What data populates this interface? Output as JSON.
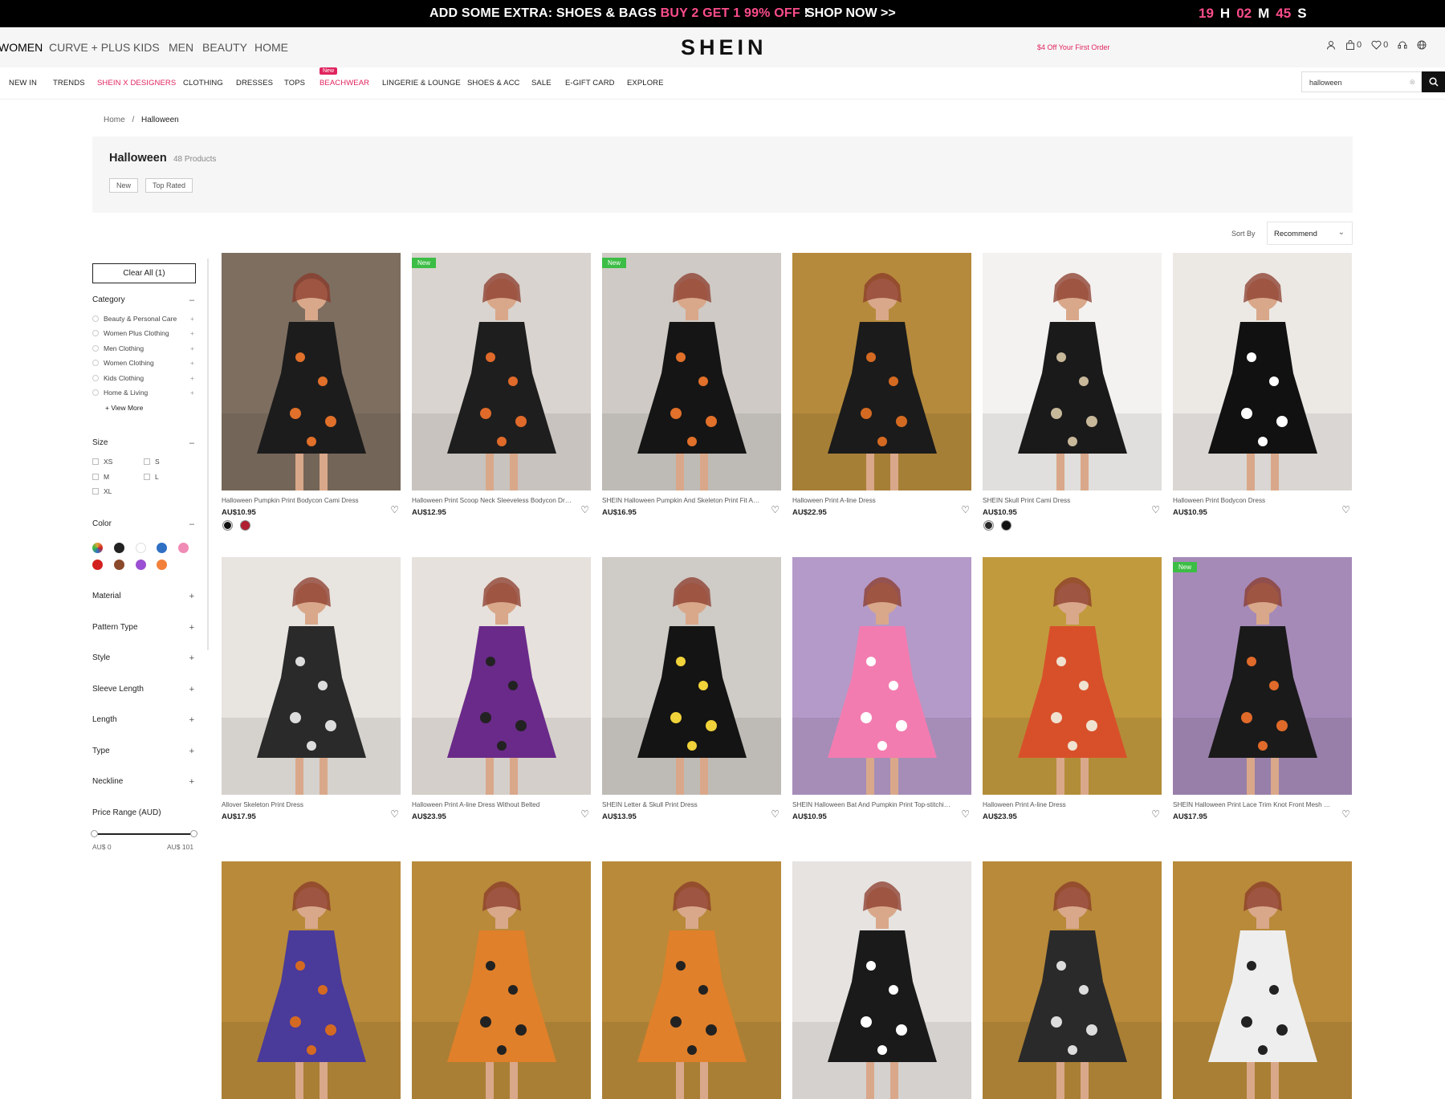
{
  "promo": {
    "part1": "ADD SOME EXTRA: SHOES & BAGS ",
    "highlight": "BUY 2 GET 1 99% OFF",
    "part2": " !",
    "shop": "SHOP NOW >>",
    "hours": "19",
    "h": "H",
    "minutes": "02",
    "m": "M",
    "seconds": "45",
    "s": "S"
  },
  "header": {
    "categories": [
      "WOMEN",
      "CURVE + PLUS",
      "KIDS",
      "MEN",
      "BEAUTY",
      "HOME"
    ],
    "logo": "SHEIN",
    "offer": "$4 Off Your First Order",
    "bag_count": "0",
    "wish_count": "0"
  },
  "nav": {
    "items": [
      "NEW IN",
      "TRENDS",
      "SHEIN X DESIGNERS",
      "CLOTHING",
      "DRESSES",
      "TOPS",
      "BEACHWEAR",
      "LINGERIE & LOUNGE",
      "SHOES & ACC",
      "SALE",
      "E-GIFT CARD",
      "EXPLORE"
    ],
    "new_badge": "New",
    "search_value": "halloween"
  },
  "breadcrumb": {
    "home": "Home",
    "sep": "/",
    "current": "Halloween"
  },
  "listing": {
    "title": "Halloween",
    "count": "48 Products",
    "chip_new": "New",
    "chip_top": "Top Rated",
    "sort_label": "Sort By",
    "sort_value": "Recommend"
  },
  "filters": {
    "clear_all": "Clear All (1)",
    "category": "Category",
    "category_items": [
      "Beauty & Personal Care",
      "Women Plus Clothing",
      "Men Clothing",
      "Women Clothing",
      "Kids Clothing",
      "Home & Living"
    ],
    "view_more": "+ View More",
    "size": "Size",
    "sizes": [
      "XS",
      "S",
      "M",
      "L",
      "XL"
    ],
    "color": "Color",
    "colors": [
      "#e8a23a",
      "#222222",
      "#ffffff",
      "#2f6fc4",
      "#f08bb5",
      "#d22020",
      "#8b4a2b",
      "#9b4fd2",
      "#f2803a"
    ],
    "material": "Material",
    "pattern_type": "Pattern Type",
    "style": "Style",
    "sleeve_length": "Sleeve Length",
    "length": "Length",
    "type": "Type",
    "neckline": "Neckline",
    "price_range": "Price Range (AUD)",
    "price_min": "AU$ 0",
    "price_max": "AU$ 101",
    "minus": "–",
    "plus": "+"
  },
  "products": [
    {
      "name": "Halloween Pumpkin Print Bodycon Cami Dress",
      "price": "AU$10.95",
      "badge": "",
      "bg": "#7d6e60",
      "dress": "#1c1c1c",
      "accent": "#e0702a",
      "dots": [
        "#111111",
        "#b02030"
      ]
    },
    {
      "name": "Halloween Print Scoop Neck Sleeveless Bodycon Dress",
      "price": "AU$12.95",
      "badge": "New",
      "bg": "#d9d4cf",
      "dress": "#1e1e1e",
      "accent": "#e06a2a",
      "dots": []
    },
    {
      "name": "SHEIN Halloween Pumpkin And Skeleton Print Fit And Flare Dress",
      "price": "AU$16.95",
      "badge": "New",
      "bg": "#cfcac5",
      "dress": "#151515",
      "accent": "#e0702a",
      "dots": []
    },
    {
      "name": "Halloween Print A-line Dress",
      "price": "AU$22.95",
      "badge": "",
      "bg": "#b58a3c",
      "dress": "#1b1b1b",
      "accent": "#d46a22",
      "dots": []
    },
    {
      "name": "SHEIN Skull Print Cami Dress",
      "price": "AU$10.95",
      "badge": "",
      "bg": "#f4f2f0",
      "dress": "#1a1a1a",
      "accent": "#c8b89a",
      "dots": [
        "#2a2a2a",
        "#111111"
      ]
    },
    {
      "name": "Halloween Print Bodycon Dress",
      "price": "AU$10.95",
      "badge": "",
      "bg": "#ece9e5",
      "dress": "#111111",
      "accent": "#ffffff",
      "dots": []
    },
    {
      "name": "Allover Skeleton Print Dress",
      "price": "AU$17.95",
      "badge": "",
      "bg": "#e8e4e0",
      "dress": "#2a2a2a",
      "accent": "#dddddd",
      "dots": []
    },
    {
      "name": "Halloween Print A-line Dress Without Belted",
      "price": "AU$23.95",
      "badge": "",
      "bg": "#e6e1dc",
      "dress": "#6a2a8a",
      "accent": "#222222",
      "dots": []
    },
    {
      "name": "SHEIN Letter & Skull Print Dress",
      "price": "AU$13.95",
      "badge": "",
      "bg": "#cfcbc6",
      "dress": "#141414",
      "accent": "#f0d23a",
      "dots": []
    },
    {
      "name": "SHEIN Halloween Bat And Pumpkin Print Top-stitching Bodycon Dress",
      "price": "AU$10.95",
      "badge": "",
      "bg": "#b49ac8",
      "dress": "#f27cb0",
      "accent": "#ffffff",
      "dots": []
    },
    {
      "name": "Halloween Print A-line Dress",
      "price": "AU$23.95",
      "badge": "",
      "bg": "#c29a3e",
      "dress": "#d8502a",
      "accent": "#f0e2d0",
      "dots": []
    },
    {
      "name": "SHEIN Halloween Print Lace Trim Knot Front Mesh Cami Dress",
      "price": "AU$17.95",
      "badge": "New",
      "bg": "#a58ab8",
      "dress": "#1a1a1a",
      "accent": "#e06a2a",
      "dots": []
    },
    {
      "name": "",
      "price": "",
      "badge": "",
      "bg": "#b88a3a",
      "dress": "#4a3a9a",
      "accent": "#d46a22",
      "dots": []
    },
    {
      "name": "",
      "price": "",
      "badge": "",
      "bg": "#b88a3a",
      "dress": "#e0802a",
      "accent": "#222222",
      "dots": []
    },
    {
      "name": "",
      "price": "",
      "badge": "",
      "bg": "#b88a3a",
      "dress": "#e0802a",
      "accent": "#222222",
      "dots": []
    },
    {
      "name": "",
      "price": "",
      "badge": "",
      "bg": "#e6e3e0",
      "dress": "#1a1a1a",
      "accent": "#ffffff",
      "dots": []
    },
    {
      "name": "",
      "price": "",
      "badge": "",
      "bg": "#b88a3a",
      "dress": "#2a2a2a",
      "accent": "#dddddd",
      "dots": []
    },
    {
      "name": "",
      "price": "",
      "badge": "",
      "bg": "#b88a3a",
      "dress": "#eeeeee",
      "accent": "#222222",
      "dots": []
    }
  ]
}
